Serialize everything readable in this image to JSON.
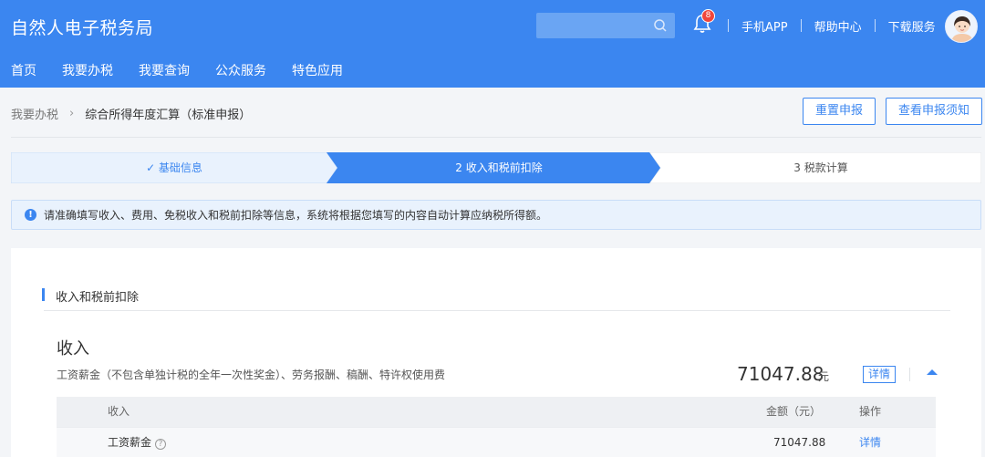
{
  "header": {
    "title": "自然人电子税务局",
    "search": {
      "value": "",
      "placeholder": ""
    },
    "notifications_count": "8",
    "links": [
      "手机APP",
      "帮助中心",
      "下载服务"
    ]
  },
  "nav": {
    "items": [
      "首页",
      "我要办税",
      "我要查询",
      "公众服务",
      "特色应用"
    ]
  },
  "breadcrumb": {
    "parent": "我要办税",
    "current": "综合所得年度汇算（标准申报）"
  },
  "actions": {
    "reset": "重置申报",
    "view_notice": "查看申报须知"
  },
  "steps": [
    {
      "label": "✓ 基础信息",
      "state": "done"
    },
    {
      "label": "2 收入和税前扣除",
      "state": "active"
    },
    {
      "label": "3 税款计算",
      "state": "pending"
    }
  ],
  "notice": {
    "text": "请准确填写收入、费用、免税收入和税前扣除等信息，系统将根据您填写的内容自动计算应纳税所得额。"
  },
  "section": {
    "title": "收入和税前扣除"
  },
  "income": {
    "title": "收入",
    "description": "工资薪金（不包含单独计税的全年一次性奖金）、劳务报酬、稿酬、特许权使用费",
    "amount": "71047.88",
    "unit": "元",
    "detail_label": "详情",
    "table": {
      "headers": [
        "收入",
        "金额（元）",
        "操作"
      ],
      "rows": [
        {
          "name": "工资薪金",
          "amount": "71047.88",
          "action": "详情"
        }
      ]
    }
  },
  "colors": {
    "primary": "#3b86f0",
    "step_done_bg": "#e9f2fd",
    "step_pending_bg": "#ffffff"
  }
}
